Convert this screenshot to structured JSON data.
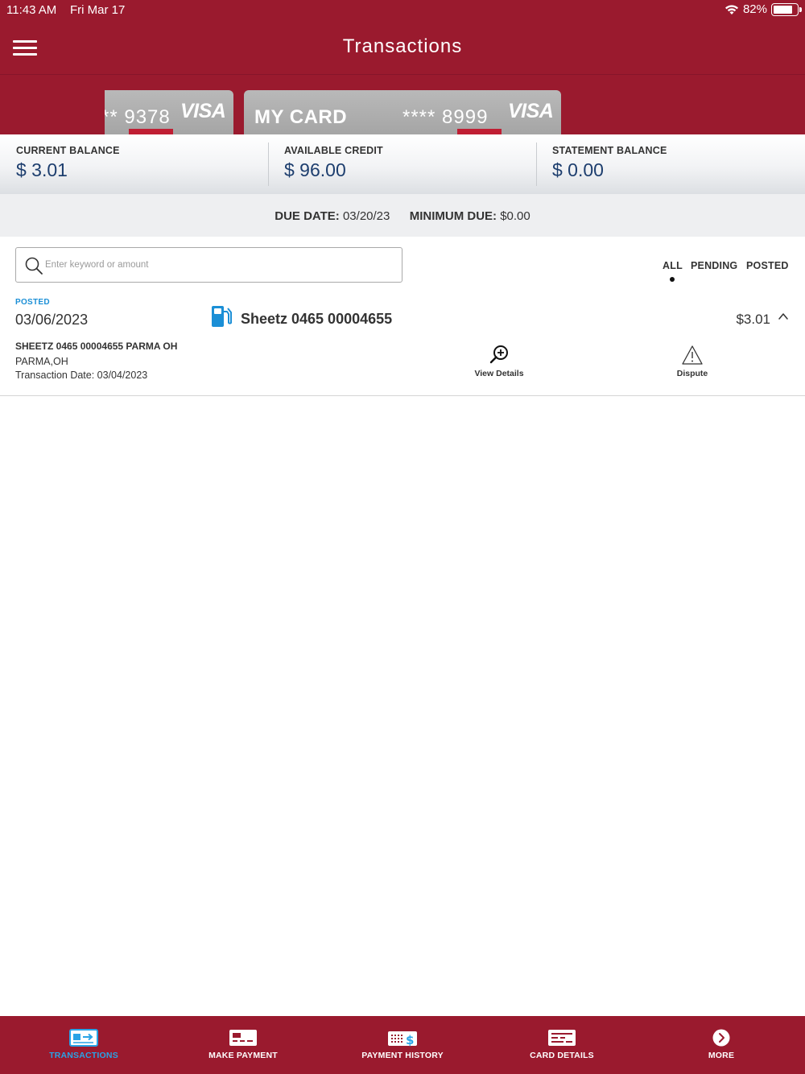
{
  "status_bar": {
    "time": "11:43 AM",
    "date": "Fri Mar 17",
    "battery": "82%",
    "battery_level": 0.82
  },
  "header": {
    "title": "Transactions"
  },
  "cards": [
    {
      "name": "",
      "number": "** 9378",
      "network": "VISA"
    },
    {
      "name": "MY CARD",
      "number": "**** 8999",
      "network": "VISA"
    }
  ],
  "balances": {
    "current_label": "CURRENT BALANCE",
    "current_value": "$ 3.01",
    "available_label": "AVAILABLE CREDIT",
    "available_value": "$ 96.00",
    "statement_label": "STATEMENT BALANCE",
    "statement_value": "$ 0.00"
  },
  "due": {
    "due_label": "DUE DATE:",
    "due_value": "03/20/23",
    "min_label": "MINIMUM DUE:",
    "min_value": "$0.00"
  },
  "search": {
    "placeholder": "Enter keyword or amount",
    "value": ""
  },
  "filters": {
    "all": "ALL",
    "pending": "PENDING",
    "posted": "POSTED",
    "selected": "ALL"
  },
  "transactions": [
    {
      "status": "POSTED",
      "date": "03/06/2023",
      "merchant": "Sheetz 0465 00004655",
      "amount": "$3.01",
      "description": "SHEETZ 0465 00004655 PARMA OH",
      "location": "PARMA,OH",
      "transaction_date": "Transaction Date: 03/04/2023",
      "actions": {
        "view_details": "View Details",
        "dispute": "Dispute"
      },
      "icon": "gas-pump-icon"
    }
  ],
  "tabbar": {
    "transactions": "TRANSACTIONS",
    "make_payment": "MAKE PAYMENT",
    "payment_history": "PAYMENT HISTORY",
    "card_details": "CARD DETAILS",
    "more": "MORE",
    "active": "TRANSACTIONS"
  },
  "colors": {
    "brand_red": "#9a1a2e",
    "accent_blue": "#1b8fd6",
    "balance_blue": "#1d3e6e"
  }
}
